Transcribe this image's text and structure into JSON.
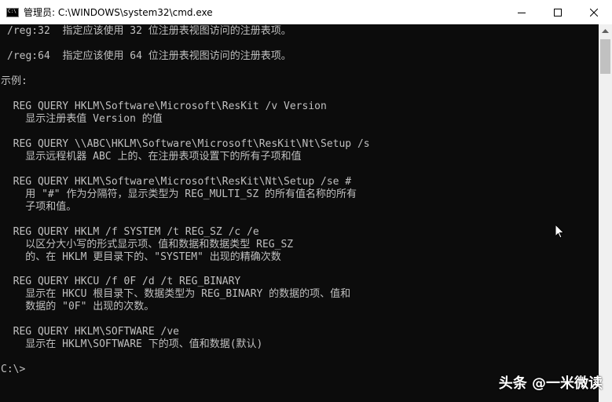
{
  "window": {
    "title": "管理员: C:\\WINDOWS\\system32\\cmd.exe",
    "icon": "cmd-icon",
    "icon_text": "C:\\"
  },
  "controls": {
    "minimize": "minimize-icon",
    "maximize": "maximize-icon",
    "close": "close-icon"
  },
  "console": {
    "text_color": "#c0c0c0",
    "background": "#0c0c0c",
    "lines": [
      "/reg:32  指定应该使用 32 位注册表视图访问的注册表项。",
      "/reg:64  指定应该使用 64 位注册表视图访问的注册表项。",
      "示例:",
      "  REG QUERY HKLM\\Software\\Microsoft\\ResKit /v Version",
      "    显示注册表值 Version 的值",
      "  REG QUERY \\\\ABC\\HKLM\\Software\\Microsoft\\ResKit\\Nt\\Setup /s",
      "    显示远程机器 ABC 上的、在注册表项设置下的所有子项和值",
      "  REG QUERY HKLM\\Software\\Microsoft\\ResKit\\Nt\\Setup /se #",
      "    用 \"#\" 作为分隔符，显示类型为 REG_MULTI_SZ 的所有值名称的所有",
      "    子项和值。",
      "  REG QUERY HKLM /f SYSTEM /t REG_SZ /c /e",
      "    以区分大小写的形式显示项、值和数据和数据类型 REG_SZ",
      "    的、在 HKLM 更目录下的、\"SYSTEM\" 出现的精确次数",
      "  REG QUERY HKCU /f 0F /d /t REG_BINARY",
      "    显示在 HKCU 根目录下、数据类型为 REG_BINARY 的数据的项、值和",
      "    数据的 \"0F\" 出现的次数。",
      "  REG QUERY HKLM\\SOFTWARE /ve",
      "    显示在 HKLM\\SOFTWARE 下的项、值和数据(默认)",
      "C:\\>"
    ]
  },
  "watermark": "头条 @一米微读"
}
